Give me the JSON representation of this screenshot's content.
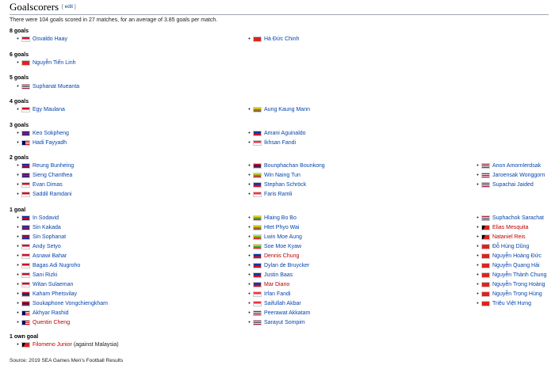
{
  "section": {
    "title": "Goalscorers",
    "edit_label": "edit"
  },
  "intro": "There were 104 goals scored in 27 matches, for an average of 3.85 goals per match.",
  "groups": [
    {
      "heading": "8 goals",
      "columns": [
        [
          {
            "name": "Osvaldo Haay",
            "flag": "IDN"
          }
        ],
        [
          {
            "name": "Hà Đức Chinh",
            "flag": "VIE"
          }
        ]
      ]
    },
    {
      "heading": "6 goals",
      "columns": [
        [
          {
            "name": "Nguyễn Tiến Linh",
            "flag": "VIE"
          }
        ]
      ]
    },
    {
      "heading": "5 goals",
      "columns": [
        [
          {
            "name": "Suphanat Mueanta",
            "flag": "THA"
          }
        ]
      ]
    },
    {
      "heading": "4 goals",
      "columns": [
        [
          {
            "name": "Egy Maulana",
            "flag": "IDN"
          }
        ],
        [
          {
            "name": "Aung Kaung Mann",
            "flag": "MYA"
          }
        ]
      ]
    },
    {
      "heading": "3 goals",
      "columns": [
        [
          {
            "name": "Keo Sokpheng",
            "flag": "CAM"
          },
          {
            "name": "Hadi Fayyadh",
            "flag": "MAS"
          }
        ],
        [
          {
            "name": "Amani Aguinaldo",
            "flag": "PHI"
          },
          {
            "name": "Ikhsan Fandi",
            "flag": "SGP"
          }
        ]
      ]
    },
    {
      "heading": "2 goals",
      "columns": [
        [
          {
            "name": "Reung Bunheing",
            "flag": "CAM"
          },
          {
            "name": "Sieng Chanthea",
            "flag": "CAM"
          },
          {
            "name": "Evan Dimas",
            "flag": "IDN"
          },
          {
            "name": "Saddil Ramdani",
            "flag": "IDN"
          }
        ],
        [
          {
            "name": "Bounphachan Bounkong",
            "flag": "LAO"
          },
          {
            "name": "Win Naing Tun",
            "flag": "MYA"
          },
          {
            "name": "Stephan Schröck",
            "flag": "PHI"
          },
          {
            "name": "Faris Ramli",
            "flag": "SGP"
          }
        ],
        [
          {
            "name": "Anon Amornlerdsak",
            "flag": "THA"
          },
          {
            "name": "Jaroensak Wonggorn",
            "flag": "THA"
          },
          {
            "name": "Supachai Jaided",
            "flag": "THA"
          }
        ]
      ]
    },
    {
      "heading": "1 goal",
      "columns": [
        [
          {
            "name": "In Sodavid",
            "flag": "CAM"
          },
          {
            "name": "Sin Kakada",
            "flag": "CAM"
          },
          {
            "name": "Sin Sophanat",
            "flag": "CAM"
          },
          {
            "name": "Andy Setyo",
            "flag": "IDN"
          },
          {
            "name": "Asnawi Bahar",
            "flag": "IDN"
          },
          {
            "name": "Bagas Adi Nugroho",
            "flag": "IDN"
          },
          {
            "name": "Sani Rizki",
            "flag": "IDN"
          },
          {
            "name": "Witan Sulaeman",
            "flag": "IDN"
          },
          {
            "name": "Kaham Phetsvilay",
            "flag": "LAO"
          },
          {
            "name": "Soukaphone Vongchiengkham",
            "flag": "LAO"
          },
          {
            "name": "Akhyar Rashid",
            "flag": "MAS"
          },
          {
            "name": "Quentin Cheng",
            "flag": "MAS",
            "red": true
          }
        ],
        [
          {
            "name": "Hlaing Bo Bo",
            "flag": "MYA"
          },
          {
            "name": "Htet Phyo Wai",
            "flag": "MYA"
          },
          {
            "name": "Lwin Moe Aung",
            "flag": "MYA"
          },
          {
            "name": "Soe Moe Kyaw",
            "flag": "MYA"
          },
          {
            "name": "Dennis Chung",
            "flag": "PHI",
            "red": true
          },
          {
            "name": "Dylan de Bruycker",
            "flag": "PHI"
          },
          {
            "name": "Justin Baas",
            "flag": "PHI"
          },
          {
            "name": "Mar Diano",
            "flag": "PHI",
            "red": true
          },
          {
            "name": "Irfan Fandi",
            "flag": "SGP"
          },
          {
            "name": "Saifullah Akbar",
            "flag": "SGP"
          },
          {
            "name": "Peerawat Akkatam",
            "flag": "THA"
          },
          {
            "name": "Sarayut Sompim",
            "flag": "THA"
          }
        ],
        [
          {
            "name": "Suphachok Sarachat",
            "flag": "THA"
          },
          {
            "name": "Elias Mesquita",
            "flag": "TLS",
            "red": true
          },
          {
            "name": "Nataniel Reis",
            "flag": "TLS",
            "red": true
          },
          {
            "name": "Đỗ Hùng Dũng",
            "flag": "VIE"
          },
          {
            "name": "Nguyễn Hoàng Đức",
            "flag": "VIE"
          },
          {
            "name": "Nguyễn Quang Hải",
            "flag": "VIE"
          },
          {
            "name": "Nguyễn Thành Chung",
            "flag": "VIE"
          },
          {
            "name": "Nguyễn Trọng Hoàng",
            "flag": "VIE"
          },
          {
            "name": "Nguyễn Trọng Hùng",
            "flag": "VIE"
          },
          {
            "name": "Triệu Việt Hưng",
            "flag": "VIE"
          }
        ]
      ]
    },
    {
      "heading": "1 own goal",
      "columns": [
        [
          {
            "name": "Filomeno Junior",
            "flag": "TLS",
            "red": true,
            "suffix": "(against Malaysia)"
          }
        ]
      ]
    }
  ],
  "source": "Source: 2019 SEA Games Men's Football Results",
  "flag_colors": {
    "IDN": [
      "#ce1126",
      "#ffffff"
    ],
    "VIE": [
      "#da251d"
    ],
    "THA": [
      "#a51931",
      "#f4f5f8",
      "#2d2a4a",
      "#f4f5f8",
      "#a51931"
    ],
    "MYA": [
      "#fecb00",
      "#34b233",
      "#ea2839"
    ],
    "CAM": [
      "#032ea1",
      "#e00025",
      "#032ea1"
    ],
    "MAS": [
      "#cc0001",
      "#ffffff",
      "#cc0001",
      "#ffffff",
      "#010066"
    ],
    "PHI": [
      "#0038a8",
      "#ce1126"
    ],
    "SGP": [
      "#ef3340",
      "#ffffff"
    ],
    "LAO": [
      "#ce1126",
      "#002868",
      "#ce1126"
    ],
    "TLS": [
      "#dc241f",
      "#000000"
    ]
  }
}
